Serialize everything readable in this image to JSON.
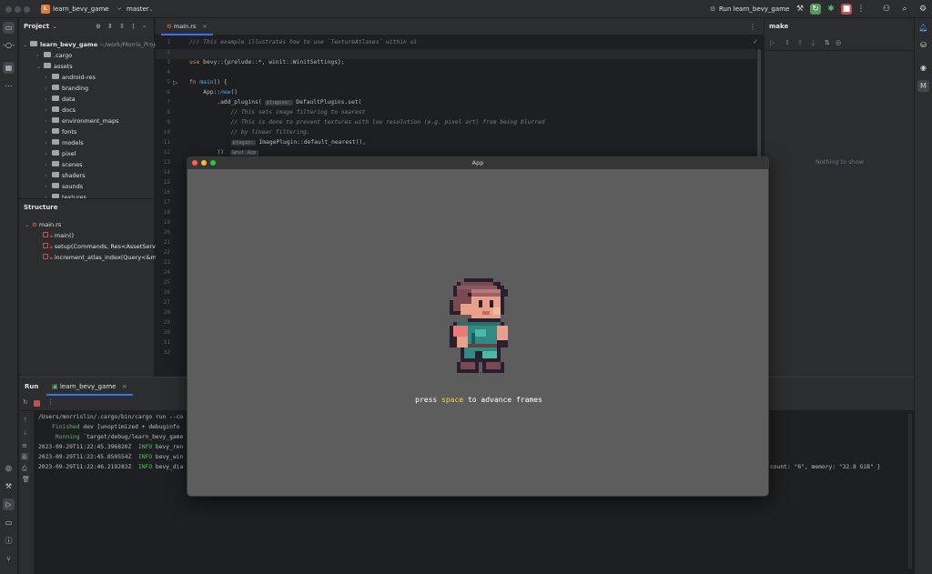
{
  "titlebar": {
    "project_initial": "L",
    "project_name": "learn_bevy_game",
    "branch": "master",
    "run_config": "Run learn_bevy_game"
  },
  "project_panel": {
    "title": "Project",
    "root_name": "learn_bevy_game",
    "root_path": "~/work/Morris_Projec",
    "items": [
      {
        "label": ".cargo",
        "depth": 1
      },
      {
        "label": "assets",
        "depth": 1
      },
      {
        "label": "android-res",
        "depth": 2
      },
      {
        "label": "branding",
        "depth": 2
      },
      {
        "label": "data",
        "depth": 2
      },
      {
        "label": "docs",
        "depth": 2
      },
      {
        "label": "environment_maps",
        "depth": 2
      },
      {
        "label": "fonts",
        "depth": 2
      },
      {
        "label": "models",
        "depth": 2
      },
      {
        "label": "pixel",
        "depth": 2
      },
      {
        "label": "scenes",
        "depth": 2
      },
      {
        "label": "shaders",
        "depth": 2
      },
      {
        "label": "sounds",
        "depth": 2
      },
      {
        "label": "textures",
        "depth": 2
      }
    ]
  },
  "structure_panel": {
    "title": "Structure",
    "file": "main.rs",
    "items": [
      "main()",
      "setup(Commands, Res<AssetServe",
      "increment_atlas_index(Query<&mu"
    ]
  },
  "editor": {
    "tab_label": "main.rs",
    "lines": [
      {
        "n": "1",
        "t": "/// This example illustrates how to use `TextureAtlases` within ui"
      },
      {
        "n": "2",
        "t": ""
      },
      {
        "n": "3",
        "t": "use bevy::{prelude::*, winit::WinitSettings};"
      },
      {
        "n": "4",
        "t": ""
      },
      {
        "n": "5",
        "t": "fn main() {"
      },
      {
        "n": "6",
        "t": "    App::new()"
      },
      {
        "n": "7",
        "t": "        .add_plugins("
      },
      {
        "n": "8",
        "t": "            // This sets image filtering to nearest"
      },
      {
        "n": "9",
        "t": "            // This is done to prevent textures with low resolution (e.g. pixel art) from being blurred"
      },
      {
        "n": "10",
        "t": "            // by linear filtering."
      },
      {
        "n": "11",
        "t": "            ImagePlugin::default_nearest(),"
      },
      {
        "n": "12",
        "t": "        ))"
      }
    ],
    "hint_plugins": "plugins:",
    "default_plugins_set": "DefaultPlugins.set(",
    "hint_plugin": "plugin:",
    "hint_mut_app": "&mut App",
    "hidden_line_numbers": [
      "13",
      "14",
      "15",
      "16",
      "17",
      "18",
      "19",
      "20",
      "21",
      "22",
      "23",
      "24",
      "25",
      "26",
      "27",
      "28",
      "29",
      "30",
      "31",
      "32"
    ]
  },
  "make_panel": {
    "title": "make",
    "empty_text": "Nothing to show"
  },
  "run_panel": {
    "tab_run": "Run",
    "tab_config": "learn_bevy_game",
    "log": {
      "cmd": "/Users/morrislin/.cargo/bin/cargo run --co",
      "finished_word": "Finished",
      "finished_rest": " dev [unoptimized + debuginfo",
      "running_word": "Running",
      "running_rest": " `target/debug/learn_bevy_game",
      "l1_time": "2023-09-29T11:22:45.396820Z",
      "l1_level": "INFO",
      "l1_mod": "bevy_ren",
      "l2_time": "2023-09-29T11:22:45.850554Z",
      "l2_level": "INFO",
      "l2_mod": "bevy_win",
      "l3_time": "2023-09-29T11:22:46.219283Z",
      "l3_level": "INFO",
      "l3_mod": "bevy_dia",
      "l3_tail": "count: \"6\", memory: \"32.8 GiB\" }"
    }
  },
  "app_window": {
    "title": "App",
    "message_pre": "press ",
    "message_key": "space",
    "message_post": " to advance frames",
    "bg_color": "#5d5d5d",
    "key_color": "#f5d347"
  }
}
